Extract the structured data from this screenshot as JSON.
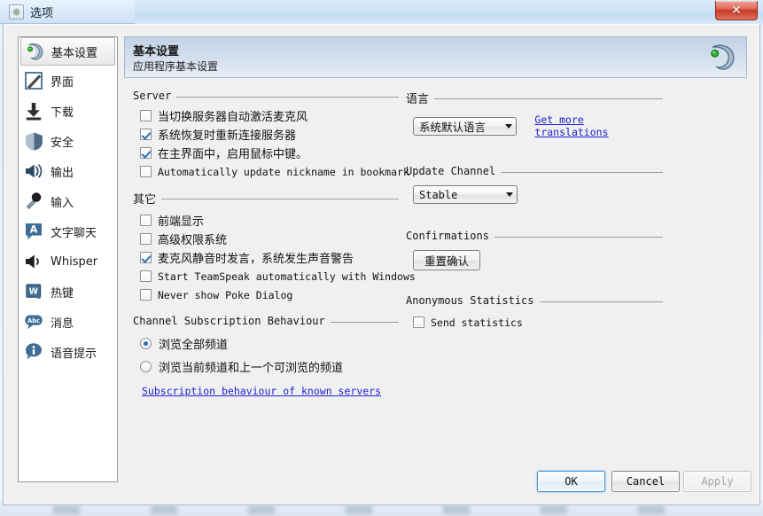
{
  "window": {
    "title": "选项",
    "title_icon": "gear-icon",
    "close_label": "✕"
  },
  "sidebar": {
    "items": [
      {
        "label": "基本设置",
        "icon": "teamspeak-logo-icon",
        "selected": true
      },
      {
        "label": "界面",
        "icon": "pencil-square-icon",
        "selected": false
      },
      {
        "label": "下载",
        "icon": "download-arrow-icon",
        "selected": false
      },
      {
        "label": "安全",
        "icon": "shield-icon",
        "selected": false
      },
      {
        "label": "输出",
        "icon": "speaker-output-icon",
        "selected": false
      },
      {
        "label": "输入",
        "icon": "microphone-icon",
        "selected": false
      },
      {
        "label": "文字聊天",
        "icon": "chat-bubble-a-icon",
        "selected": false
      },
      {
        "label": "Whisper",
        "icon": "speaker-whisper-icon",
        "selected": false
      },
      {
        "label": "热键",
        "icon": "keyboard-w-icon",
        "selected": false
      },
      {
        "label": "消息",
        "icon": "abc-bubble-icon",
        "selected": false
      },
      {
        "label": "语音提示",
        "icon": "info-bubble-icon",
        "selected": false
      }
    ]
  },
  "header": {
    "title": "基本设置",
    "subtitle": "应用程序基本设置",
    "logo_icon": "teamspeak-logo-icon"
  },
  "left_column": {
    "server": {
      "title": "Server",
      "options": [
        {
          "label": "当切换服务器自动激活麦克风",
          "checked": false,
          "mono": false
        },
        {
          "label": "系统恢复时重新连接服务器",
          "checked": true,
          "mono": false
        },
        {
          "label": "在主界面中，启用鼠标中键。",
          "checked": true,
          "mono": false
        },
        {
          "label": "Automatically update nickname in bookmark",
          "checked": false,
          "mono": true
        }
      ]
    },
    "other": {
      "title": "其它",
      "options": [
        {
          "label": "前端显示",
          "checked": false,
          "mono": false
        },
        {
          "label": "高级权限系统",
          "checked": false,
          "mono": false
        },
        {
          "label": "麦克风静音时发言，系统发生声音警告",
          "checked": true,
          "mono": false
        },
        {
          "label": "Start TeamSpeak automatically with Windows",
          "checked": false,
          "mono": true
        },
        {
          "label": "Never show Poke Dialog",
          "checked": false,
          "mono": true
        }
      ]
    },
    "subscription": {
      "title": "Channel Subscription Behaviour",
      "options": [
        {
          "label": "浏览全部频道",
          "selected": true
        },
        {
          "label": "浏览当前频道和上一个可浏览的频道",
          "selected": false
        }
      ],
      "link": "Subscription behaviour of known servers"
    }
  },
  "right_column": {
    "language": {
      "title": "语言",
      "selected": "系统默认语言",
      "link": "Get more translations"
    },
    "update_channel": {
      "title": "Update Channel",
      "selected": "Stable"
    },
    "confirmations": {
      "title": "Confirmations",
      "reset_button": "重置确认"
    },
    "anonymous_statistics": {
      "title": "Anonymous Statistics",
      "option": {
        "label": "Send statistics",
        "checked": false
      }
    }
  },
  "footer": {
    "ok": "OK",
    "cancel": "Cancel",
    "apply": "Apply",
    "apply_disabled": true
  },
  "colors": {
    "dialog_bg": "#f0f0f0",
    "header_gradient_top": "#c3d2e4",
    "accent_blue": "#2a6fba",
    "link_blue": "#2020d0",
    "close_red": "#c63a28"
  }
}
